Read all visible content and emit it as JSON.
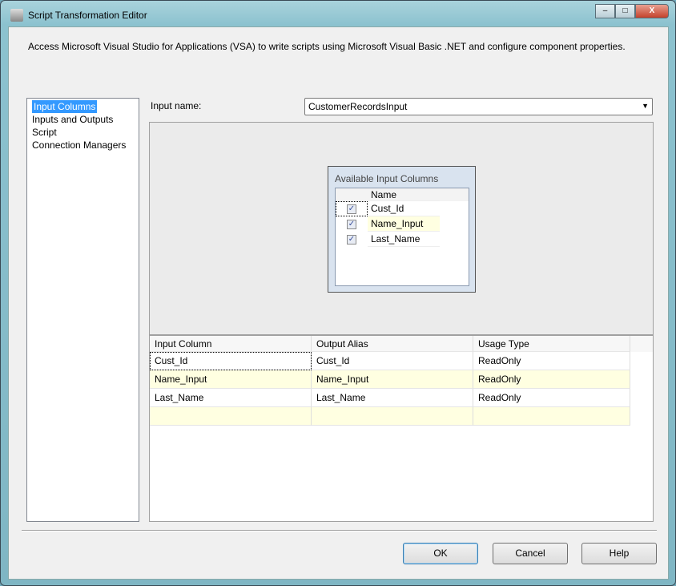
{
  "window": {
    "title": "Script Transformation Editor",
    "minimize": "–",
    "maximize": "□",
    "close": "X"
  },
  "description": "Access Microsoft Visual Studio for Applications (VSA) to write scripts using Microsoft Visual Basic .NET and configure component properties.",
  "nav": [
    "Input Columns",
    "Inputs and Outputs",
    "Script",
    "Connection Managers"
  ],
  "input_name_label": "Input name:",
  "input_name_value": "CustomerRecordsInput",
  "available": {
    "title": "Available Input Columns",
    "header": "Name",
    "rows": [
      {
        "name": "Cust_Id",
        "checked": true
      },
      {
        "name": "Name_Input",
        "checked": true
      },
      {
        "name": "Last_Name",
        "checked": true
      }
    ]
  },
  "grid": {
    "headers": [
      "Input Column",
      "Output Alias",
      "Usage Type"
    ],
    "rows": [
      [
        "Cust_Id",
        "Cust_Id",
        "ReadOnly"
      ],
      [
        "Name_Input",
        "Name_Input",
        "ReadOnly"
      ],
      [
        "Last_Name",
        "Last_Name",
        "ReadOnly"
      ]
    ]
  },
  "buttons": {
    "ok": "OK",
    "cancel": "Cancel",
    "help": "Help"
  }
}
